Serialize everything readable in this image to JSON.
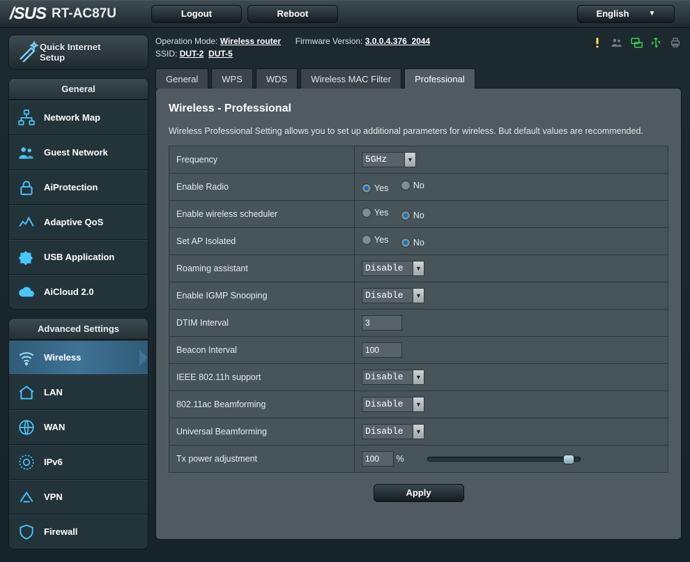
{
  "header": {
    "brand": "/SUS",
    "model": "RT-AC87U",
    "logout": "Logout",
    "reboot": "Reboot",
    "language": "English"
  },
  "info": {
    "op_mode_label": "Operation Mode:",
    "op_mode_value": "Wireless router",
    "fw_label": "Firmware Version:",
    "fw_value": "3.0.0.4.376_2044",
    "ssid_label": "SSID:",
    "ssid1": "DUT-2",
    "ssid2": "DUT-5"
  },
  "quick": {
    "line1": "Quick Internet",
    "line2": "Setup"
  },
  "sidebar": {
    "general_title": "General",
    "general_items": [
      {
        "label": "Network Map"
      },
      {
        "label": "Guest Network"
      },
      {
        "label": "AiProtection"
      },
      {
        "label": "Adaptive QoS"
      },
      {
        "label": "USB Application"
      },
      {
        "label": "AiCloud 2.0"
      }
    ],
    "adv_title": "Advanced Settings",
    "adv_items": [
      {
        "label": "Wireless"
      },
      {
        "label": "LAN"
      },
      {
        "label": "WAN"
      },
      {
        "label": "IPv6"
      },
      {
        "label": "VPN"
      },
      {
        "label": "Firewall"
      }
    ]
  },
  "tabs": [
    "General",
    "WPS",
    "WDS",
    "Wireless MAC Filter",
    "Professional"
  ],
  "page": {
    "title": "Wireless - Professional",
    "desc": "Wireless Professional Setting allows you to set up additional parameters for wireless. But default values are recommended.",
    "apply": "Apply",
    "yes": "Yes",
    "no": "No",
    "percent": "%",
    "rows": {
      "frequency": {
        "label": "Frequency",
        "value": "5GHz"
      },
      "enable_radio": {
        "label": "Enable Radio",
        "value": "yes"
      },
      "enable_sched": {
        "label": "Enable wireless scheduler",
        "value": "no"
      },
      "ap_isolated": {
        "label": "Set AP Isolated",
        "value": "no"
      },
      "roaming": {
        "label": "Roaming assistant",
        "value": "Disable"
      },
      "igmp": {
        "label": "Enable IGMP Snooping",
        "value": "Disable"
      },
      "dtim": {
        "label": "DTIM Interval",
        "value": "3"
      },
      "beacon": {
        "label": "Beacon Interval",
        "value": "100"
      },
      "ieee80211h": {
        "label": "IEEE 802.11h support",
        "value": "Disable"
      },
      "beamforming_ac": {
        "label": "802.11ac Beamforming",
        "value": "Disable"
      },
      "beamforming_uni": {
        "label": "Universal Beamforming",
        "value": "Disable"
      },
      "txpower": {
        "label": "Tx power adjustment",
        "value": "100",
        "slider_pct": 95
      }
    }
  }
}
